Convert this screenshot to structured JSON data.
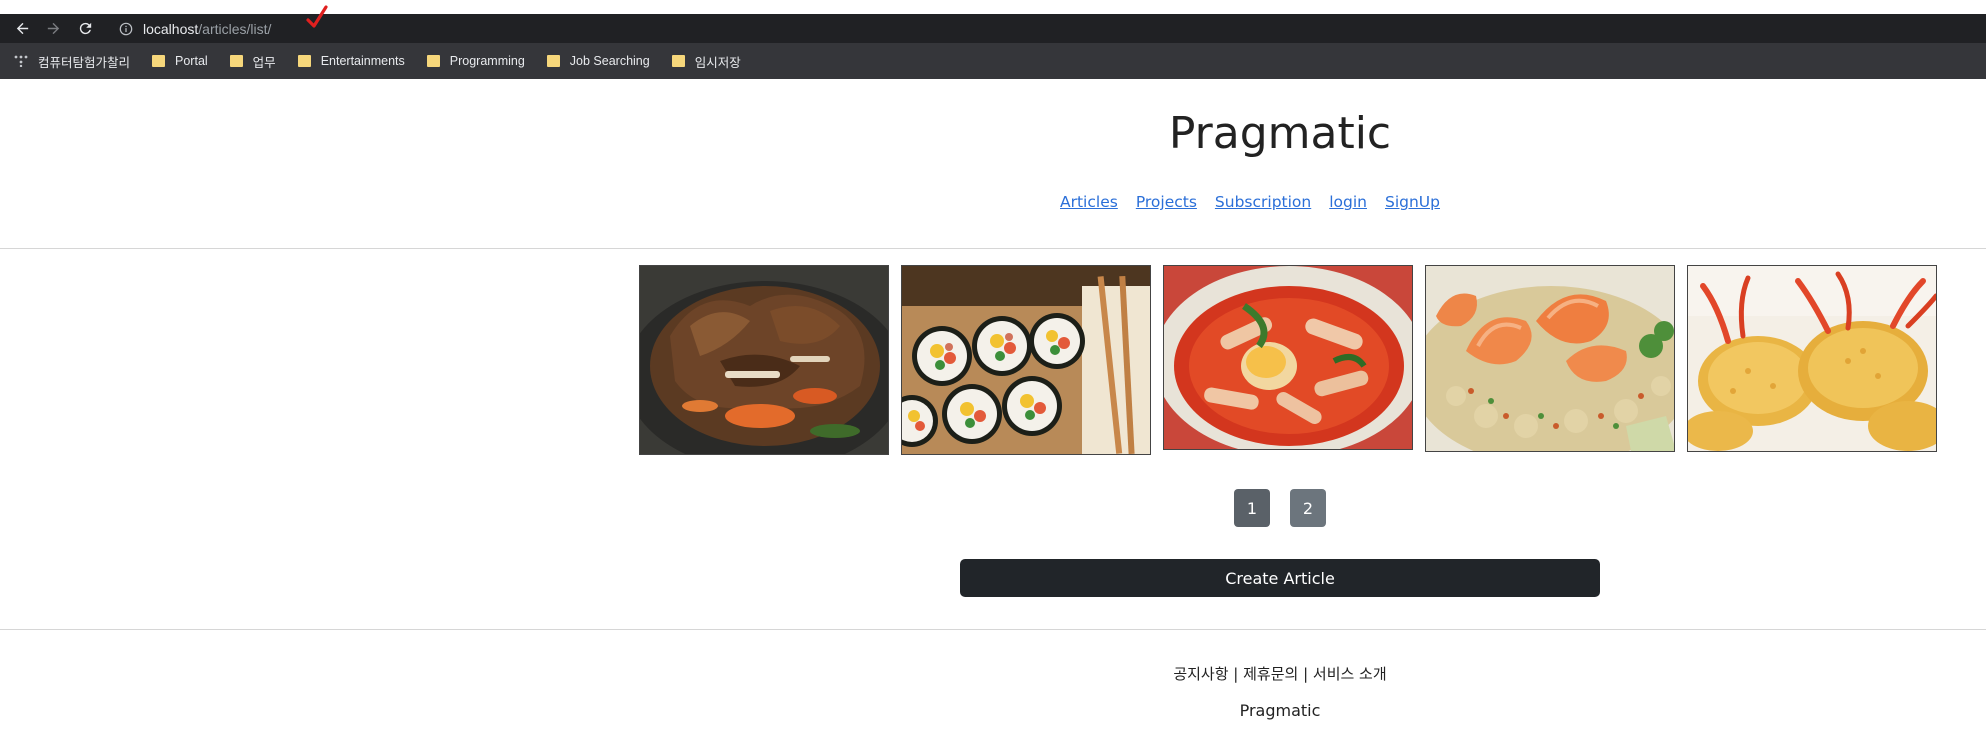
{
  "browser": {
    "url_host": "localhost",
    "url_path": "/articles/list/",
    "bookmarks": [
      {
        "label": "컴퓨터탐험가찰리",
        "icon": "apps-icon"
      },
      {
        "label": "Portal",
        "icon": "folder-icon"
      },
      {
        "label": "업무",
        "icon": "folder-icon"
      },
      {
        "label": "Entertainments",
        "icon": "folder-icon"
      },
      {
        "label": "Programming",
        "icon": "folder-icon"
      },
      {
        "label": "Job Searching",
        "icon": "folder-icon"
      },
      {
        "label": "임시저장",
        "icon": "folder-icon"
      }
    ]
  },
  "header": {
    "brand": "Pragmatic",
    "nav": [
      "Articles",
      "Projects",
      "Subscription",
      "login",
      "SignUp"
    ]
  },
  "gallery": {
    "items": [
      {
        "image": "galbi-stew-photo"
      },
      {
        "image": "gimbap-photo"
      },
      {
        "image": "tteokbokki-photo"
      },
      {
        "image": "shrimp-fried-rice-photo"
      },
      {
        "image": "fried-shrimp-photo"
      }
    ]
  },
  "pagination": {
    "pages": [
      "1",
      "2"
    ],
    "active": "1"
  },
  "actions": {
    "create_label": "Create Article"
  },
  "footer": {
    "links_text": "공지사항 | 제휴문의 | 서비스 소개",
    "brand": "Pragmatic"
  },
  "colors": {
    "link": "#2b6fd8",
    "button_dark": "#212529",
    "pager": "#6c757d",
    "chrome_dark": "#202124"
  }
}
